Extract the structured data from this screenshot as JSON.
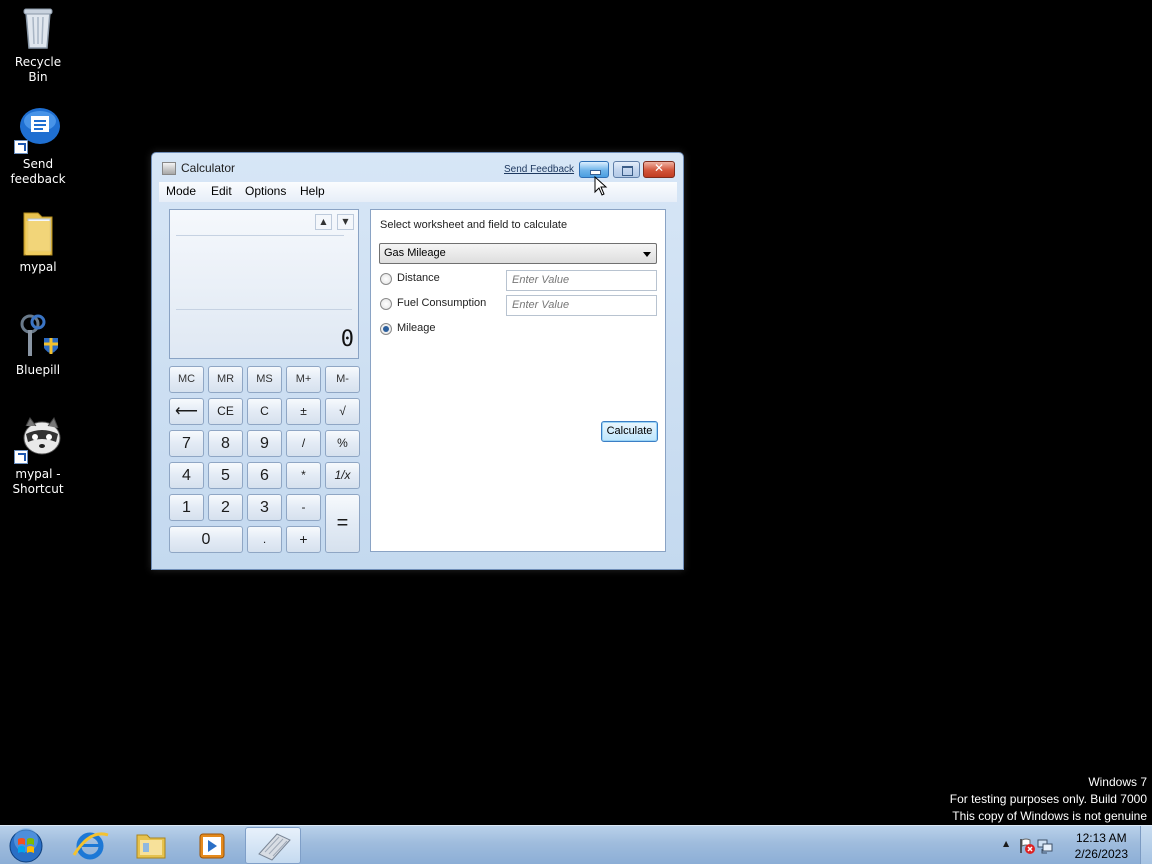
{
  "desktop": {
    "icons": [
      {
        "label": "Recycle Bin"
      },
      {
        "label": "Send feedback"
      },
      {
        "label": "mypal"
      },
      {
        "label": "Bluepill"
      },
      {
        "label": "mypal - Shortcut"
      }
    ],
    "watermark": {
      "line1": "Windows 7",
      "line2": "For testing purposes only. Build 7000",
      "line3": "This copy of Windows is not genuine"
    }
  },
  "window": {
    "title": "Calculator",
    "send_feedback": "Send Feedback",
    "menu": [
      "Mode",
      "Edit",
      "Options",
      "Help"
    ],
    "display": {
      "up_arrow": "▲",
      "down_arrow": "▼",
      "value": "0"
    },
    "keys": {
      "memory": [
        "MC",
        "MR",
        "MS",
        "M+",
        "M-"
      ],
      "row2": [
        "⟵",
        "CE",
        "C",
        "±",
        "√"
      ],
      "row3": [
        "7",
        "8",
        "9",
        "/",
        "%"
      ],
      "row4": [
        "4",
        "5",
        "6",
        "*",
        "1/x"
      ],
      "row5": [
        "1",
        "2",
        "3",
        "-"
      ],
      "row6": [
        "0",
        ".",
        "+"
      ],
      "equals": "="
    },
    "worksheet": {
      "prompt": "Select worksheet and field to calculate",
      "selected_worksheet": "Gas Mileage",
      "fields": [
        {
          "label": "Distance",
          "placeholder": "Enter Value",
          "selected": false
        },
        {
          "label": "Fuel Consumption",
          "placeholder": "Enter Value",
          "selected": false
        },
        {
          "label": "Mileage",
          "selected": true
        }
      ],
      "calculate_label": "Calculate"
    }
  },
  "taskbar": {
    "clock_time": "12:13 AM",
    "clock_date": "2/26/2023",
    "tray_arrow": "▲"
  }
}
